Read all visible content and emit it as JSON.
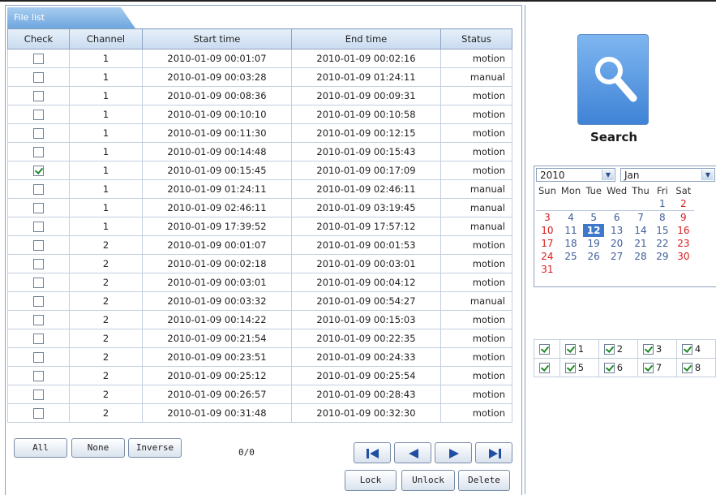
{
  "file_list": {
    "tab_title": "File list",
    "columns": [
      "Check",
      "Channel",
      "Start time",
      "End time",
      "Status"
    ],
    "rows": [
      {
        "checked": false,
        "channel": "1",
        "start": "2010-01-09 00:01:07",
        "end": "2010-01-09 00:02:16",
        "status": "motion"
      },
      {
        "checked": false,
        "channel": "1",
        "start": "2010-01-09 00:03:28",
        "end": "2010-01-09 01:24:11",
        "status": "manual"
      },
      {
        "checked": false,
        "channel": "1",
        "start": "2010-01-09 00:08:36",
        "end": "2010-01-09 00:09:31",
        "status": "motion"
      },
      {
        "checked": false,
        "channel": "1",
        "start": "2010-01-09 00:10:10",
        "end": "2010-01-09 00:10:58",
        "status": "motion"
      },
      {
        "checked": false,
        "channel": "1",
        "start": "2010-01-09 00:11:30",
        "end": "2010-01-09 00:12:15",
        "status": "motion"
      },
      {
        "checked": false,
        "channel": "1",
        "start": "2010-01-09 00:14:48",
        "end": "2010-01-09 00:15:43",
        "status": "motion"
      },
      {
        "checked": true,
        "channel": "1",
        "start": "2010-01-09 00:15:45",
        "end": "2010-01-09 00:17:09",
        "status": "motion"
      },
      {
        "checked": false,
        "channel": "1",
        "start": "2010-01-09 01:24:11",
        "end": "2010-01-09 02:46:11",
        "status": "manual"
      },
      {
        "checked": false,
        "channel": "1",
        "start": "2010-01-09 02:46:11",
        "end": "2010-01-09 03:19:45",
        "status": "manual"
      },
      {
        "checked": false,
        "channel": "1",
        "start": "2010-01-09 17:39:52",
        "end": "2010-01-09 17:57:12",
        "status": "manual"
      },
      {
        "checked": false,
        "channel": "2",
        "start": "2010-01-09 00:01:07",
        "end": "2010-01-09 00:01:53",
        "status": "motion"
      },
      {
        "checked": false,
        "channel": "2",
        "start": "2010-01-09 00:02:18",
        "end": "2010-01-09 00:03:01",
        "status": "motion"
      },
      {
        "checked": false,
        "channel": "2",
        "start": "2010-01-09 00:03:01",
        "end": "2010-01-09 00:04:12",
        "status": "motion"
      },
      {
        "checked": false,
        "channel": "2",
        "start": "2010-01-09 00:03:32",
        "end": "2010-01-09 00:54:27",
        "status": "manual"
      },
      {
        "checked": false,
        "channel": "2",
        "start": "2010-01-09 00:14:22",
        "end": "2010-01-09 00:15:03",
        "status": "motion"
      },
      {
        "checked": false,
        "channel": "2",
        "start": "2010-01-09 00:21:54",
        "end": "2010-01-09 00:22:35",
        "status": "motion"
      },
      {
        "checked": false,
        "channel": "2",
        "start": "2010-01-09 00:23:51",
        "end": "2010-01-09 00:24:33",
        "status": "motion"
      },
      {
        "checked": false,
        "channel": "2",
        "start": "2010-01-09 00:25:12",
        "end": "2010-01-09 00:25:54",
        "status": "motion"
      },
      {
        "checked": false,
        "channel": "2",
        "start": "2010-01-09 00:26:57",
        "end": "2010-01-09 00:28:43",
        "status": "motion"
      },
      {
        "checked": false,
        "channel": "2",
        "start": "2010-01-09 00:31:48",
        "end": "2010-01-09 00:32:30",
        "status": "motion"
      }
    ]
  },
  "selection": {
    "all_label": "All",
    "none_label": "None",
    "inverse_label": "Inverse",
    "page_count": "0/0"
  },
  "navigation": {
    "icons": [
      "first-page-icon",
      "previous-page-icon",
      "next-page-icon",
      "last-page-icon"
    ]
  },
  "actions": {
    "lock_label": "Lock",
    "unlock_label": "Unlock",
    "delete_label": "Delete"
  },
  "search": {
    "label": "Search",
    "icon": "magnifier-icon"
  },
  "calendar": {
    "year": "2010",
    "month": "Jan",
    "weekdays": [
      "Sun",
      "Mon",
      "Tue",
      "Wed",
      "Thu",
      "Fri",
      "Sat"
    ],
    "weeks": [
      [
        "",
        "",
        "",
        "",
        "",
        "1",
        "2"
      ],
      [
        "3",
        "4",
        "5",
        "6",
        "7",
        "8",
        "9"
      ],
      [
        "10",
        "11",
        "12",
        "13",
        "14",
        "15",
        "16"
      ],
      [
        "17",
        "18",
        "19",
        "20",
        "21",
        "22",
        "23"
      ],
      [
        "24",
        "25",
        "26",
        "27",
        "28",
        "29",
        "30"
      ],
      [
        "31",
        "",
        "",
        "",
        "",
        "",
        ""
      ]
    ],
    "selected_day": "12"
  },
  "channels": {
    "rows": [
      [
        {
          "label": "",
          "checked": true
        },
        {
          "label": "1",
          "checked": true
        },
        {
          "label": "2",
          "checked": true
        },
        {
          "label": "3",
          "checked": true
        },
        {
          "label": "4",
          "checked": true
        }
      ],
      [
        {
          "label": "",
          "checked": true
        },
        {
          "label": "5",
          "checked": true
        },
        {
          "label": "6",
          "checked": true
        },
        {
          "label": "7",
          "checked": true
        },
        {
          "label": "8",
          "checked": true
        }
      ]
    ]
  },
  "colors": {
    "accent": "#3f79c9",
    "weekend": "#d81b1b",
    "check": "#1d8a24",
    "border": "#8ea3c0"
  }
}
